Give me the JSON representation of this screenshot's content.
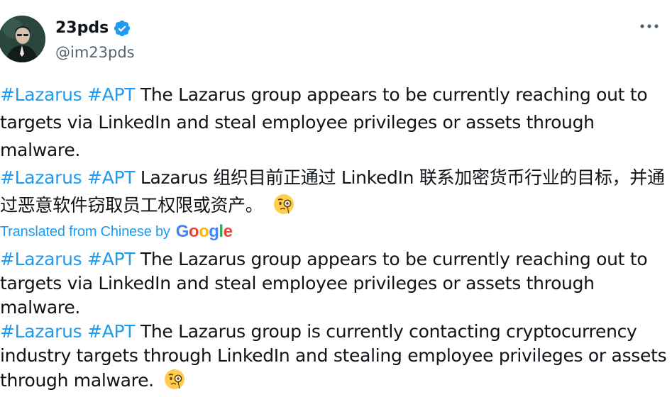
{
  "author": {
    "display_name": "23pds",
    "handle": "@im23pds",
    "verified": true
  },
  "tweet": {
    "original": {
      "para1_hashtags": [
        "#Lazarus",
        "#APT"
      ],
      "para1_text": "The Lazarus group appears to be currently reaching out to targets via LinkedIn and steal employee privileges or assets through malware.",
      "para2_hashtags": [
        "#Lazarus",
        "#APT"
      ],
      "para2_text": "Lazarus 组织目前正通过 LinkedIn 联系加密货币行业的目标，并通过恶意软件窃取员工权限或资产。",
      "para2_emoji": "face-with-monocle"
    },
    "translation": {
      "label": "Translated from Chinese by",
      "provider": "Google",
      "para1_hashtags": [
        "#Lazarus",
        "#APT"
      ],
      "para1_text": "The Lazarus group appears to be currently reaching out to targets via LinkedIn and steal employee privileges or assets through malware.",
      "para2_hashtags": [
        "#Lazarus",
        "#APT"
      ],
      "para2_text": "The Lazarus group is currently contacting cryptocurrency industry targets through LinkedIn and stealing employee privileges or assets through malware.",
      "para2_emoji": "face-with-monocle"
    }
  },
  "icons": {
    "verified": "verified-badge-icon",
    "more": "more-options-icon",
    "emoji": "face-with-monocle"
  },
  "colors": {
    "text": "#0f1419",
    "secondary_text": "#536471",
    "link": "#1d9bf0",
    "verified": "#1d9bf0"
  }
}
